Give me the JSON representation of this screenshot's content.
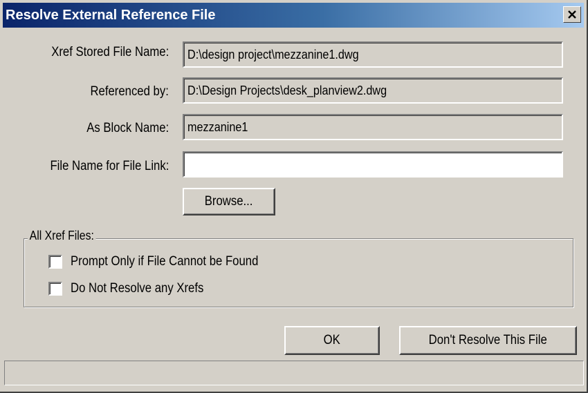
{
  "window": {
    "title": "Resolve External Reference File",
    "close_icon": "close-icon"
  },
  "fields": {
    "stored_name": {
      "label": "Xref Stored File Name:",
      "value": "D:\\design project\\mezzanine1.dwg"
    },
    "referenced_by": {
      "label": "Referenced by:",
      "value": "D:\\Design Projects\\desk_planview2.dwg"
    },
    "block_name": {
      "label": "As Block Name:",
      "value": "mezzanine1"
    },
    "file_link": {
      "label": "File Name for File Link:",
      "value": ""
    }
  },
  "browse_label": "Browse...",
  "group": {
    "title": "All Xref Files:",
    "options": [
      {
        "label": "Prompt Only if File Cannot be Found",
        "checked": false
      },
      {
        "label": "Do Not Resolve any Xrefs",
        "checked": false
      }
    ]
  },
  "buttons": {
    "ok": "OK",
    "dont_resolve": "Don't Resolve This File"
  },
  "colors": {
    "face": "#d4d0c8",
    "title_start": "#0a246a",
    "title_end": "#a6caf0"
  }
}
